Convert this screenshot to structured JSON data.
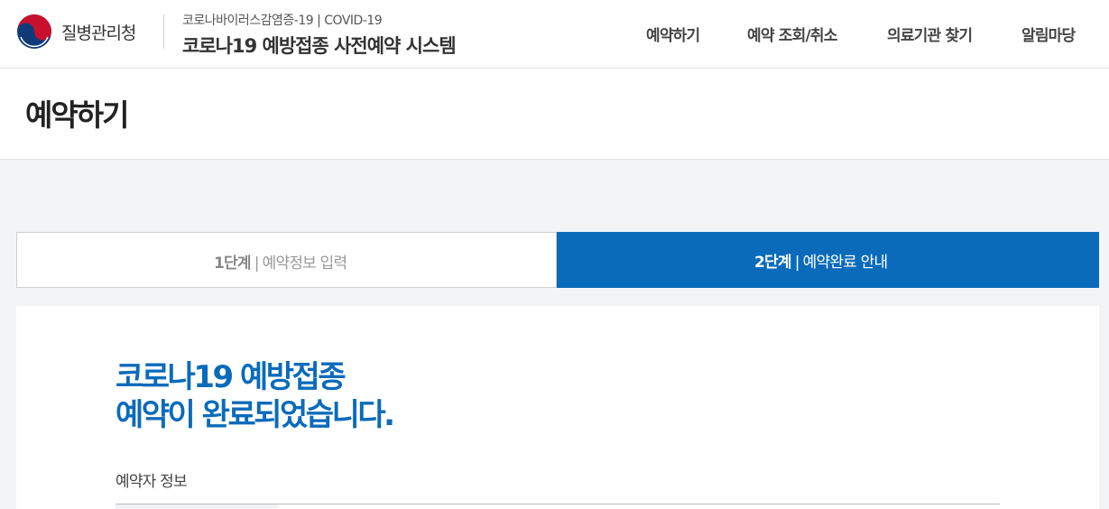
{
  "header": {
    "agency_name": "질병관리청",
    "subtitle": "코로나바이러스감염증-19 | COVID-19",
    "system_title": "코로나19 예방접종 사전예약 시스템",
    "logo_colors": {
      "red": "#c8102e",
      "blue": "#0f3b7a"
    }
  },
  "nav": {
    "items": [
      {
        "label": "예약하기"
      },
      {
        "label": "예약 조회/취소"
      },
      {
        "label": "의료기관 찾기"
      },
      {
        "label": "알림마당"
      }
    ]
  },
  "page": {
    "title": "예약하기"
  },
  "steps": [
    {
      "num": "1단계",
      "sep": "|",
      "label": "예약정보 입력",
      "active": false
    },
    {
      "num": "2단계",
      "sep": "|",
      "label": "예약완료 안내",
      "active": true
    }
  ],
  "completion": {
    "title_line1": "코로나19 예방접종",
    "title_line2": "예약이 완료되었습니다.",
    "section_label": "예약자 정보"
  },
  "colors": {
    "accent": "#0a6bbb",
    "gray_bg": "#f3f4f6"
  }
}
